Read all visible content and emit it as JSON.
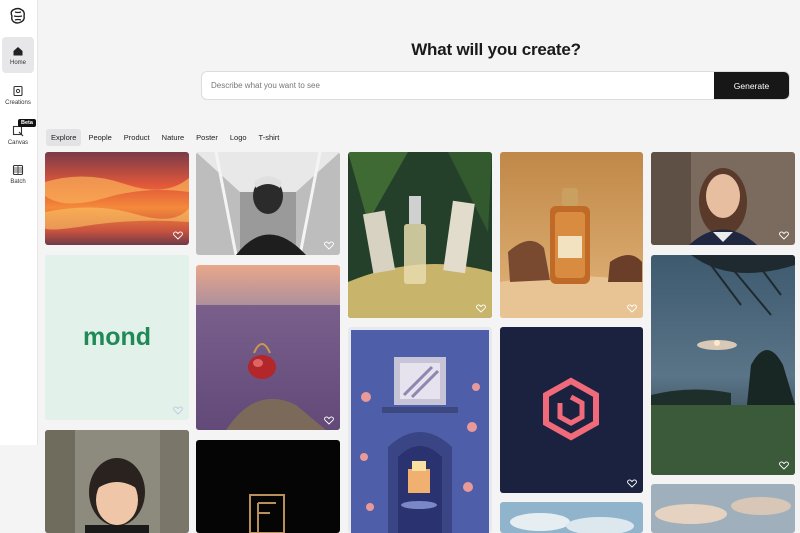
{
  "sidebar": {
    "logo_icon": "brain-logo-icon",
    "items": [
      {
        "label": "Home",
        "icon": "home-icon",
        "active": true
      },
      {
        "label": "Creations",
        "icon": "image-icon",
        "active": false
      },
      {
        "label": "Canvas",
        "icon": "canvas-icon",
        "active": false,
        "badge": "Beta"
      },
      {
        "label": "Batch",
        "icon": "grid-icon",
        "active": false
      }
    ]
  },
  "main": {
    "headline": "What will you create?",
    "search": {
      "placeholder": "Describe what you want to see",
      "value": "",
      "button_label": "Generate"
    },
    "tabs": [
      {
        "label": "Explore",
        "active": true
      },
      {
        "label": "People",
        "active": false
      },
      {
        "label": "Product",
        "active": false
      },
      {
        "label": "Nature",
        "active": false
      },
      {
        "label": "Poster",
        "active": false
      },
      {
        "label": "Logo",
        "active": false
      },
      {
        "label": "T-shirt",
        "active": false
      }
    ],
    "gallery": {
      "mond_logo_text": "mond",
      "cards": [
        {
          "name": "sunset-clouds",
          "col": 1
        },
        {
          "name": "mond-logo",
          "col": 1
        },
        {
          "name": "girl-portrait",
          "col": 1
        },
        {
          "name": "man-portrait-bw",
          "col": 2
        },
        {
          "name": "perfume-lavender-field",
          "col": 2
        },
        {
          "name": "gold-letter-logo",
          "col": 2
        },
        {
          "name": "serum-bottle-leaves",
          "col": 3
        },
        {
          "name": "fireplace-illustration",
          "col": 3
        },
        {
          "name": "perfume-bottle-gold",
          "col": 4
        },
        {
          "name": "hexagon-logo",
          "col": 4
        },
        {
          "name": "sky-clouds",
          "col": 4
        },
        {
          "name": "woman-portrait",
          "col": 5
        },
        {
          "name": "moonlit-landscape",
          "col": 5
        },
        {
          "name": "evening-sky",
          "col": 5
        }
      ]
    }
  }
}
